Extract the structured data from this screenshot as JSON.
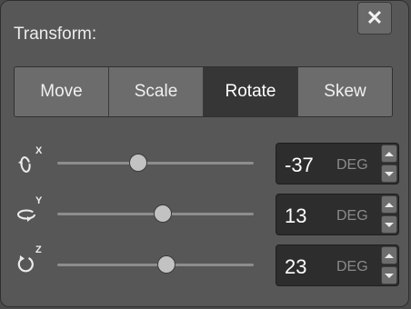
{
  "panel": {
    "title": "Transform:",
    "close_icon": "close-icon",
    "close_glyph": "✕"
  },
  "tabs": [
    {
      "label": "Move",
      "active": false
    },
    {
      "label": "Scale",
      "active": false
    },
    {
      "label": "Rotate",
      "active": true
    },
    {
      "label": "Skew",
      "active": false
    }
  ],
  "rows": [
    {
      "axis": "X",
      "icon": "rotate-x-icon",
      "value": "-37",
      "unit": "DEG",
      "slider_fraction": 0.41
    },
    {
      "axis": "Y",
      "icon": "rotate-y-icon",
      "value": "13",
      "unit": "DEG",
      "slider_fraction": 0.536
    },
    {
      "axis": "Z",
      "icon": "rotate-z-icon",
      "value": "23",
      "unit": "DEG",
      "slider_fraction": 0.555
    }
  ],
  "colors": {
    "panel_bg": "#575757",
    "active_tab": "#363636",
    "tab_bg": "#6c6c6c",
    "value_bg": "#2d2d2d",
    "thumb": "#c2c2c2"
  }
}
